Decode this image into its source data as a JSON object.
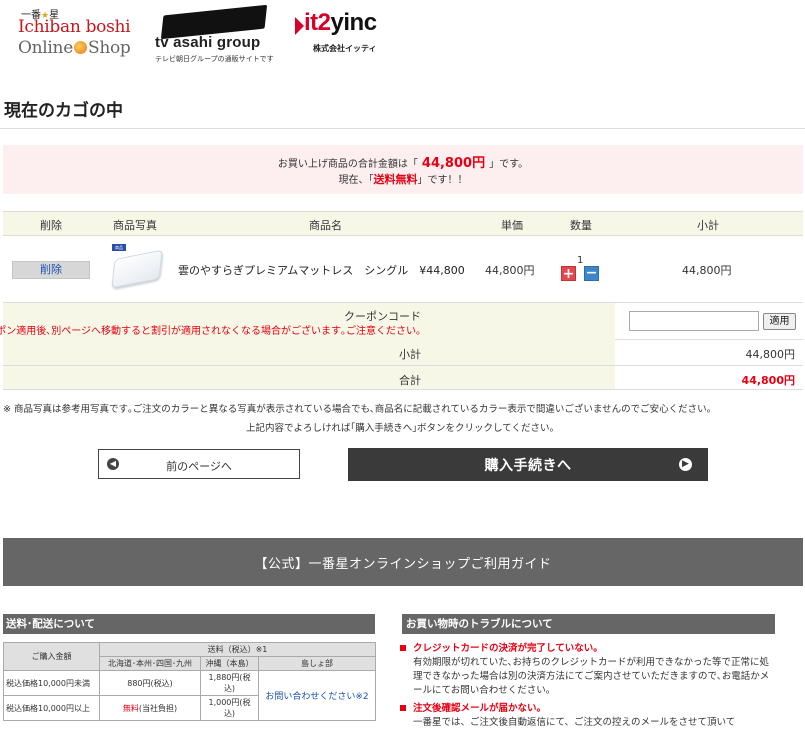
{
  "header": {
    "ichiban": {
      "top": "一番",
      "star": "★",
      "top2": "星",
      "line1": "Ichiban boshi",
      "line2a": "Online",
      "line2b": "Shop"
    },
    "tvasahi": {
      "name": "tv asahi group",
      "sub": "テレビ朝日グループの通販サイトです"
    },
    "it2": {
      "prefix": "it2",
      "suffix": "yinc",
      "sub": "株式会社イッティ"
    }
  },
  "page_title": "現在のカゴの中",
  "summary": {
    "line1_pre": "お買い上げ商品の合計金額は「",
    "amount": "44,800円",
    "line1_post": "」です。",
    "line2_pre": "現在、「",
    "free": "送料無料",
    "line2_post": "」です！！"
  },
  "cart": {
    "headers": {
      "del": "削除",
      "photo": "商品写真",
      "name": "商品名",
      "price": "単価",
      "qty": "数量",
      "subtotal": "小計"
    },
    "item": {
      "delete_label": "削除",
      "thumb_tag": "商品",
      "name": "雲のやすらぎプレミアムマットレス　シングル　¥44,800",
      "price": "44,800円",
      "qty": "1",
      "plus": "+",
      "minus": "−",
      "subtotal": "44,800円"
    },
    "coupon": {
      "title": "クーポンコード",
      "note": "※クーポン適用後､別ページへ移動すると割引が適用されなくなる場合がございます｡ご注意ください｡",
      "input_value": "",
      "apply": "適用"
    },
    "subtotal": {
      "label": "小計",
      "value": "44,800円"
    },
    "total": {
      "label": "合計",
      "value": "44,800円"
    }
  },
  "notes": {
    "note1": "※ 商品写真は参考用写真です｡ご注文のカラーと異なる写真が表示されている場合でも､商品名に記載されているカラー表示で間違いございませんのでご安心ください｡",
    "note2": "上記内容でよろしければ｢購入手続きへ｣ボタンをクリックしてください。"
  },
  "buttons": {
    "back": "前のページへ",
    "back_icon": "◀",
    "next": "購入手続きへ",
    "next_icon": "▶"
  },
  "guide": {
    "banner": "【公式】一番星オンラインショップご利用ガイド"
  },
  "shipping": {
    "heading": "送料･配送について",
    "col_amount": "ご購入金額",
    "col_fee": "送料（税込）※1",
    "regions": [
      "北海道･本州･四国･九州",
      "沖縄（本島）",
      "島しょ部"
    ],
    "rows": [
      {
        "amount": "税込価格10,000円未満",
        "main": "880円(税込)",
        "okinawa": "1,880円(税込)"
      },
      {
        "amount": "税込価格10,000円以上",
        "main_red": "無料",
        "main_rest": "(当社負担)",
        "okinawa": "1,000円(税込)"
      }
    ],
    "islands": "お問い合わせください※2"
  },
  "trouble": {
    "heading": "お買い物時のトラブルについて",
    "items": [
      {
        "title": "クレジットカードの決済が完了していない。",
        "body": "有効期限が切れていた､お持ちのクレジットカードが利用できなかった等で正常に処理できなかった場合は別の決済方法にてご案内させていただきますので､お電話かメールにてお問い合わせください。"
      },
      {
        "title": "注文後確認メールが届かない。",
        "body": "一番星では、ご注文後自動返信にて、ご注文の控えのメールをさせて頂いて"
      }
    ]
  }
}
